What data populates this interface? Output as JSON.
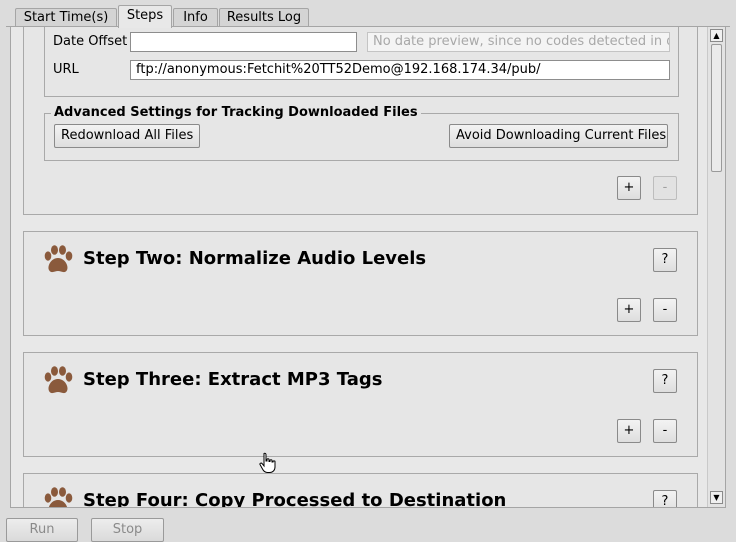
{
  "tabs": [
    {
      "label": "Start Time(s)",
      "active": false
    },
    {
      "label": "Steps",
      "active": true
    },
    {
      "label": "Info",
      "active": false
    },
    {
      "label": "Results Log",
      "active": false
    }
  ],
  "step_one": {
    "date_offset_label": "Date Offset",
    "date_offset_value": "",
    "date_preview_placeholder": "No date preview, since no codes detected in di",
    "url_label": "URL",
    "url_value": "ftp://anonymous:Fetchit%20TT52Demo@192.168.174.34/pub/",
    "advanced_title": "Advanced Settings for Tracking Downloaded Files",
    "redownload_label": "Redownload All Files",
    "avoid_label": "Avoid Downloading Current Files",
    "add_label": "+",
    "remove_label": "-"
  },
  "step_two": {
    "title": "Step Two:  Normalize Audio Levels",
    "help_label": "?",
    "add_label": "+",
    "remove_label": "-"
  },
  "step_three": {
    "title": "Step Three:  Extract MP3 Tags",
    "help_label": "?",
    "add_label": "+",
    "remove_label": "-"
  },
  "step_four": {
    "title": "Step Four:  Copy Processed to Destination",
    "help_label": "?"
  },
  "scrollbar": {
    "up_arrow": "▲",
    "down_arrow": "▼"
  },
  "footer": {
    "run_label": "Run",
    "stop_label": "Stop"
  },
  "colors": {
    "paw": "#8a5a3c",
    "panel_bg": "#e6e6e6",
    "border": "#a9a9a9"
  },
  "icons": {
    "step_icon": "paw-print-icon",
    "cursor": "hand-pointer-icon"
  }
}
